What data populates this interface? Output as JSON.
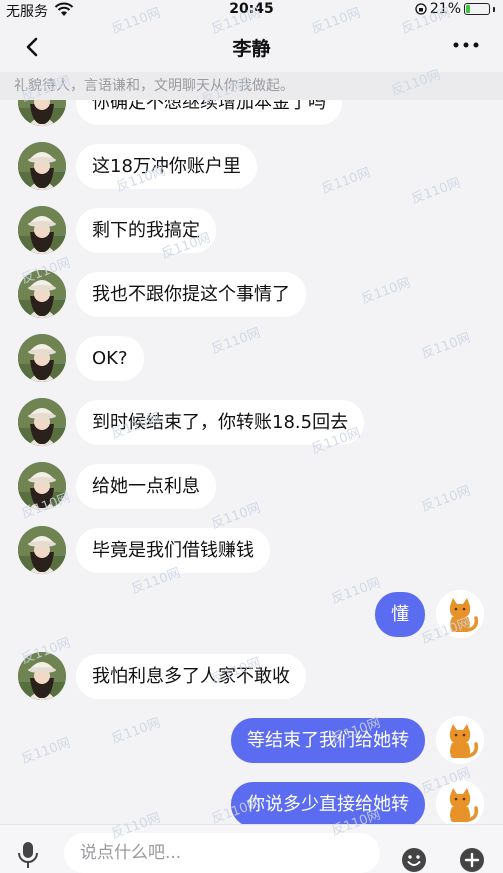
{
  "status_bar": {
    "carrier": "无服务",
    "time": "20:45",
    "battery": "21%"
  },
  "header": {
    "contact_name": "李静"
  },
  "notice": "礼貌待人，言语谦和，文明聊天从你我做起。",
  "messages": [
    {
      "side": "left",
      "text": "你确定不想继续增加本金了吗"
    },
    {
      "side": "left",
      "text": "这18万冲你账户里"
    },
    {
      "side": "left",
      "text": "剩下的我搞定"
    },
    {
      "side": "left",
      "text": "我也不跟你提这个事情了"
    },
    {
      "side": "left",
      "text": "OK?"
    },
    {
      "side": "left",
      "text": "到时候结束了，你转账18.5回去"
    },
    {
      "side": "left",
      "text": "给她一点利息"
    },
    {
      "side": "left",
      "text": "毕竟是我们借钱赚钱"
    },
    {
      "side": "right",
      "text": "懂"
    },
    {
      "side": "left",
      "text": "我怕利息多了人家不敢收"
    },
    {
      "side": "right",
      "text": "等结束了我们给她转"
    },
    {
      "side": "right",
      "text": "你说多少直接给她转"
    }
  ],
  "watermark": "反110网",
  "input": {
    "placeholder": "说点什么吧..."
  },
  "icons": {
    "back": "chevron-left-icon",
    "more": "more-dots-icon",
    "mic": "microphone-icon",
    "emoji": "emoji-icon",
    "plus": "plus-icon",
    "wifi": "wifi-icon",
    "battery": "battery-icon"
  },
  "colors": {
    "outgoing_bubble": "#5b6cf0",
    "incoming_bubble": "#ffffff",
    "background": "#f3f3f5"
  }
}
